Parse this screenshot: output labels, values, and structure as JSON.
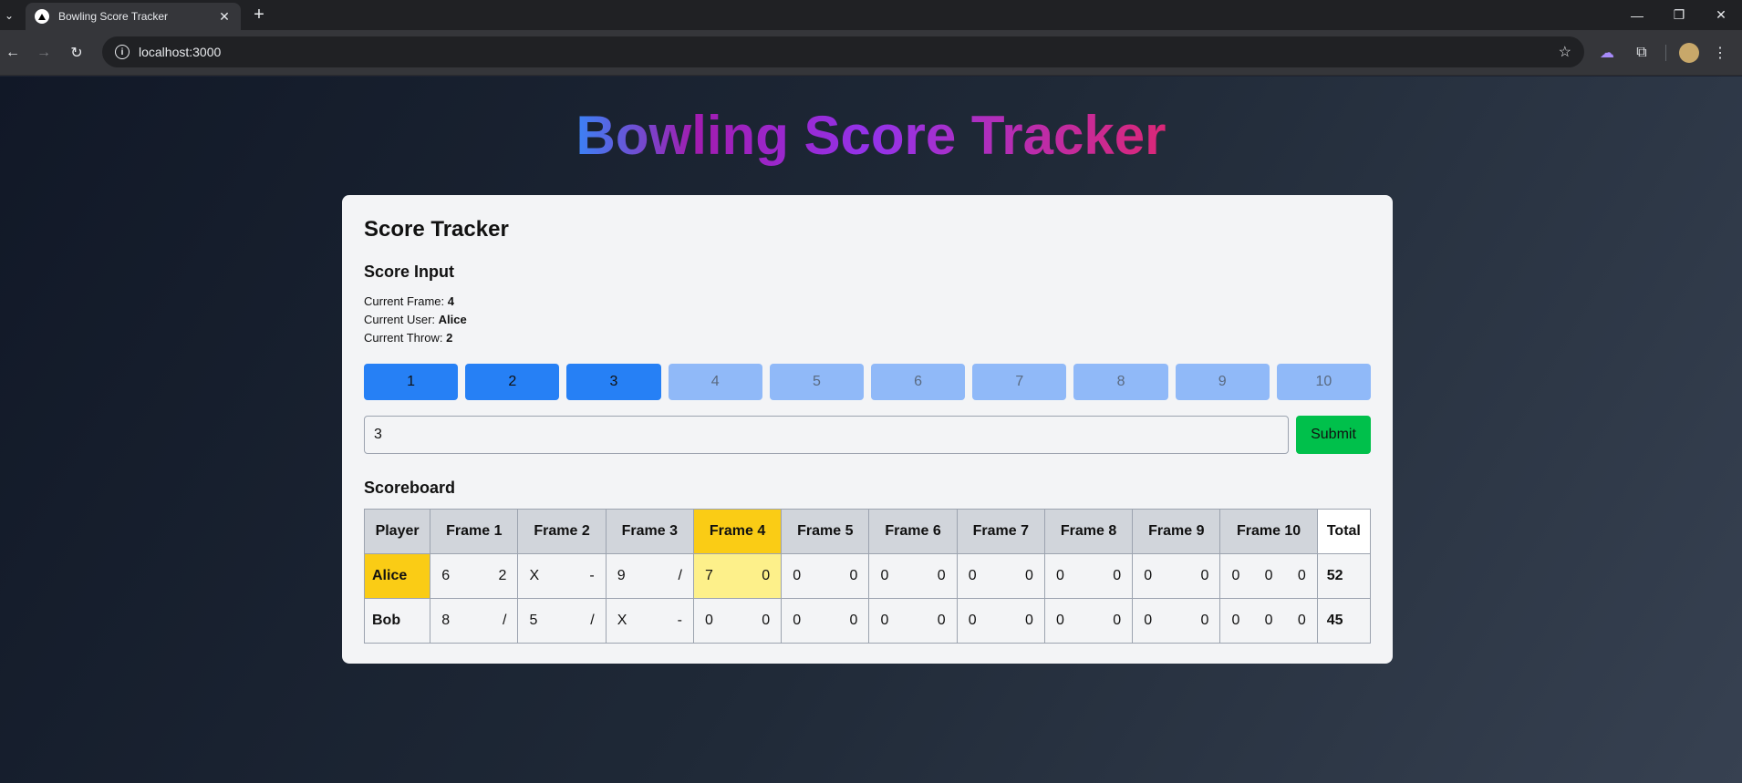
{
  "browser": {
    "tab_title": "Bowling Score Tracker",
    "url": "localhost:3000"
  },
  "page": {
    "title": "Bowling Score Tracker"
  },
  "card": {
    "title": "Score Tracker",
    "input_section": "Score Input",
    "current_frame_label": "Current Frame:",
    "current_frame": "4",
    "current_user_label": "Current User:",
    "current_user": "Alice",
    "current_throw_label": "Current Throw:",
    "current_throw": "2",
    "pins": [
      {
        "label": "1",
        "enabled": true
      },
      {
        "label": "2",
        "enabled": true
      },
      {
        "label": "3",
        "enabled": true
      },
      {
        "label": "4",
        "enabled": false
      },
      {
        "label": "5",
        "enabled": false
      },
      {
        "label": "6",
        "enabled": false
      },
      {
        "label": "7",
        "enabled": false
      },
      {
        "label": "8",
        "enabled": false
      },
      {
        "label": "9",
        "enabled": false
      },
      {
        "label": "10",
        "enabled": false
      }
    ],
    "score_input_value": "3",
    "submit_label": "Submit",
    "scoreboard_title": "Scoreboard"
  },
  "scoreboard": {
    "headers": [
      "Player",
      "Frame 1",
      "Frame 2",
      "Frame 3",
      "Frame 4",
      "Frame 5",
      "Frame 6",
      "Frame 7",
      "Frame 8",
      "Frame 9",
      "Frame 10",
      "Total"
    ],
    "rows": [
      {
        "player": "Alice",
        "frames": [
          [
            "6",
            "2"
          ],
          [
            "X",
            "-"
          ],
          [
            "9",
            "/"
          ],
          [
            "7",
            "0"
          ],
          [
            "0",
            "0"
          ],
          [
            "0",
            "0"
          ],
          [
            "0",
            "0"
          ],
          [
            "0",
            "0"
          ],
          [
            "0",
            "0"
          ],
          [
            "0",
            "0",
            "0"
          ]
        ],
        "total": "52"
      },
      {
        "player": "Bob",
        "frames": [
          [
            "8",
            "/"
          ],
          [
            "5",
            "/"
          ],
          [
            "X",
            "-"
          ],
          [
            "0",
            "0"
          ],
          [
            "0",
            "0"
          ],
          [
            "0",
            "0"
          ],
          [
            "0",
            "0"
          ],
          [
            "0",
            "0"
          ],
          [
            "0",
            "0"
          ],
          [
            "0",
            "0",
            "0"
          ]
        ],
        "total": "45"
      }
    ]
  },
  "colors": {
    "pin_enabled": "#2680f5",
    "pin_disabled": "#90b9f8",
    "submit": "#00c04b",
    "current_highlight": "#facc15"
  }
}
